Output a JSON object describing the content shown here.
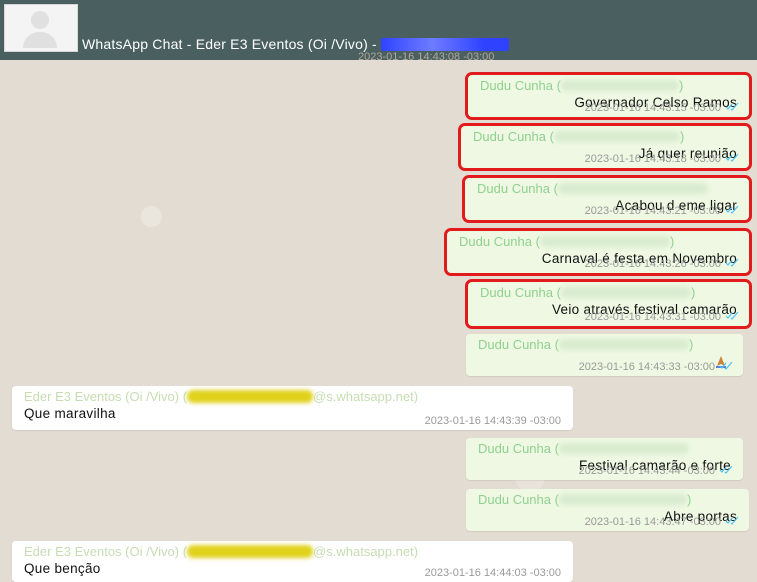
{
  "header": {
    "title": "WhatsApp Chat - Eder E3 Eventos (Oi /Vivo) -"
  },
  "chat": {
    "top_timestamp": "2023-01-16 14:43:08 -03:00",
    "messages": [
      {
        "sender": "Dudu Cunha (",
        "text": "Governador Celso Ramos",
        "time": "2023-01-16 14:43:15 -03:00"
      },
      {
        "sender": "Dudu Cunha (",
        "text": "Já quer reunião",
        "time": "2023-01-16 14:43:18 -03:00"
      },
      {
        "sender": "Dudu Cunha (",
        "text": "Acabou d eme ligar",
        "time": "2023-01-16 14:43:21 -03:00"
      },
      {
        "sender": "Dudu Cunha (",
        "text": "Carnaval é festa em Novembro",
        "time": "2023-01-16 14:43:26 -03:00"
      },
      {
        "sender": "Dudu Cunha (",
        "text": "Veio através festival camarão",
        "time": "2023-01-16 14:43:31 -03:00"
      },
      {
        "sender": "Dudu Cunha (",
        "text": "",
        "time": "2023-01-16 14:43:33 -03:00"
      },
      {
        "sender": "Eder E3 Eventos (Oi /Vivo) (",
        "sender_suffix": "@s.whatsapp.net)",
        "text": "Que maravilha",
        "time": "2023-01-16 14:43:39 -03:00"
      },
      {
        "sender": "Dudu Cunha (",
        "text": "Festival camarão e forte",
        "time": "2023-01-16 14:43:44 -03:00"
      },
      {
        "sender": "Dudu Cunha (",
        "text": "Abre portas",
        "time": "2023-01-16 14:43:47 -03:00"
      },
      {
        "sender": "Eder E3 Eventos (Oi /Vivo) (",
        "sender_suffix": "@s.whatsapp.net)",
        "text": "Que benção",
        "time": "2023-01-16 14:44:03 -03:00"
      }
    ]
  },
  "colors": {
    "header_bg": "#4a5f5f",
    "outgoing_bubble": "#eef8e2",
    "incoming_bubble": "#ffffff",
    "highlight_border": "#e11b1b",
    "read_tick": "#4fc3f7"
  }
}
